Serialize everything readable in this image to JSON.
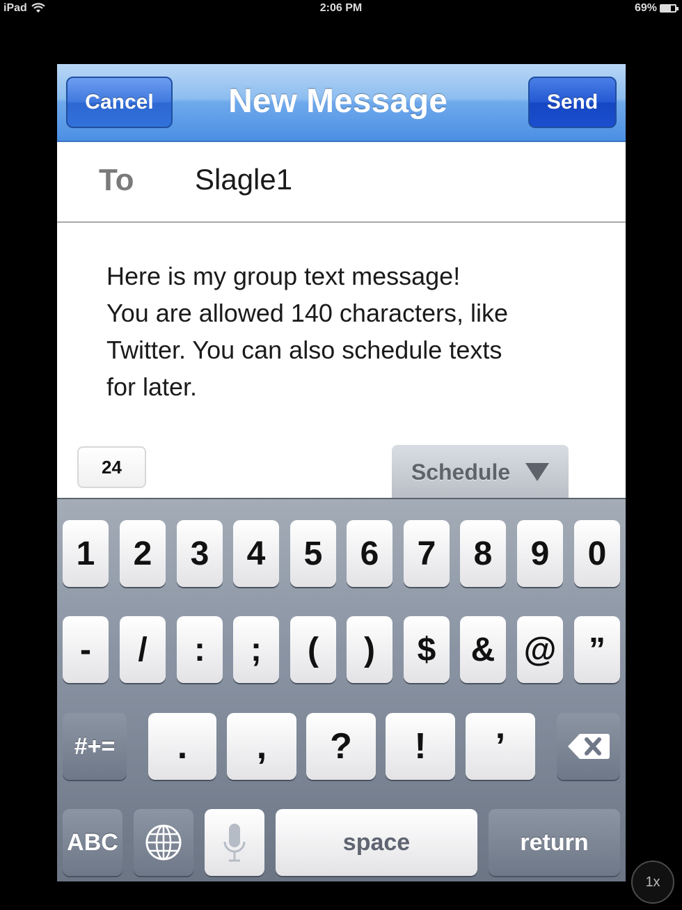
{
  "status_bar": {
    "device": "iPad",
    "time": "2:06 PM",
    "battery": "69%",
    "battery_level": 0.69
  },
  "navbar": {
    "cancel_label": "Cancel",
    "title": "New Message",
    "send_label": "Send"
  },
  "recipient": {
    "label": "To",
    "value": "Slagle1"
  },
  "message": {
    "body": "Here is my group text message! You are allowed 140 characters, like Twitter. You can also schedule texts for later.",
    "lines": [
      "Here is my group text message!",
      "You are allowed 140 characters, like",
      "Twitter. You can also schedule texts",
      "for later."
    ]
  },
  "counter": "24",
  "schedule": {
    "label": "Schedule",
    "icon": "triangle-down-icon"
  },
  "keyboard": {
    "row1": [
      "1",
      "2",
      "3",
      "4",
      "5",
      "6",
      "7",
      "8",
      "9",
      "0"
    ],
    "row2": [
      "-",
      "/",
      ":",
      ";",
      "(",
      ")",
      "$",
      "&",
      "@",
      "”"
    ],
    "row3_shift": "#+=",
    "row3": [
      ".",
      ",",
      "?",
      "!",
      "’"
    ],
    "backspace_icon": "backspace-icon",
    "abc_label": "ABC",
    "globe_icon": "globe-icon",
    "mic_icon": "microphone-icon",
    "space_label": "space",
    "return_label": "return"
  },
  "zoom_label": "1x",
  "colors": {
    "nav_blue": "#4b8fe3",
    "send_blue": "#1646c2",
    "keyboard_gray": "#8a94a3"
  }
}
